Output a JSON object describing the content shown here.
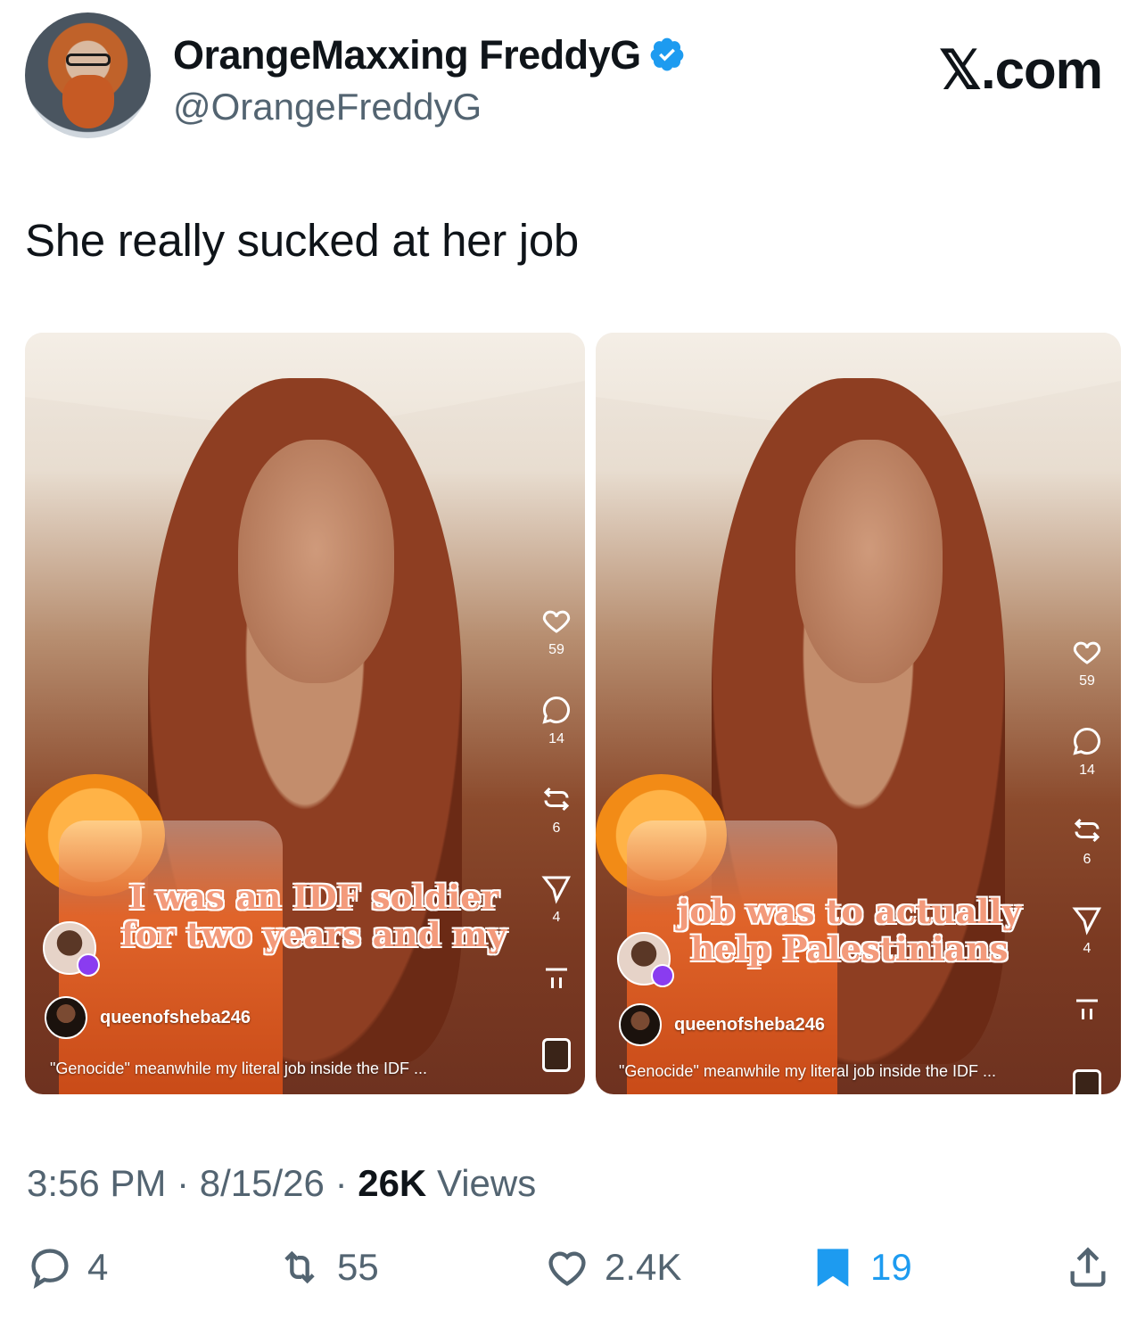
{
  "header": {
    "display_name": "OrangeMaxxing FreddyG",
    "handle": "@OrangeFreddyG",
    "brand": "𝕏.com"
  },
  "tweet": {
    "text": "She really sucked at her job",
    "time": "3:56 PM",
    "date": "8/15/26",
    "views_count": "26K",
    "views_label": "Views"
  },
  "media": [
    {
      "caption_line1": "I was an IDF soldier",
      "caption_line2": "for two years and my",
      "likes": "59",
      "comments": "14",
      "reposts": "6",
      "shares": "4",
      "creator": "queenofsheba246",
      "description": "\"Genocide\" meanwhile my literal job inside the IDF ..."
    },
    {
      "caption_line1": "job was to actually",
      "caption_line2": "help Palestinians",
      "likes": "59",
      "comments": "14",
      "reposts": "6",
      "shares": "4",
      "creator": "queenofsheba246",
      "description": "\"Genocide\" meanwhile my literal job inside the IDF ..."
    }
  ],
  "actions": {
    "replies": "4",
    "reposts": "55",
    "likes": "2.4K",
    "bookmarks": "19"
  },
  "colors": {
    "verified": "#1d9bf0",
    "bookmark_active": "#1d9bf0",
    "caption_text": "#f39a7b",
    "secondary_text": "#536471"
  }
}
